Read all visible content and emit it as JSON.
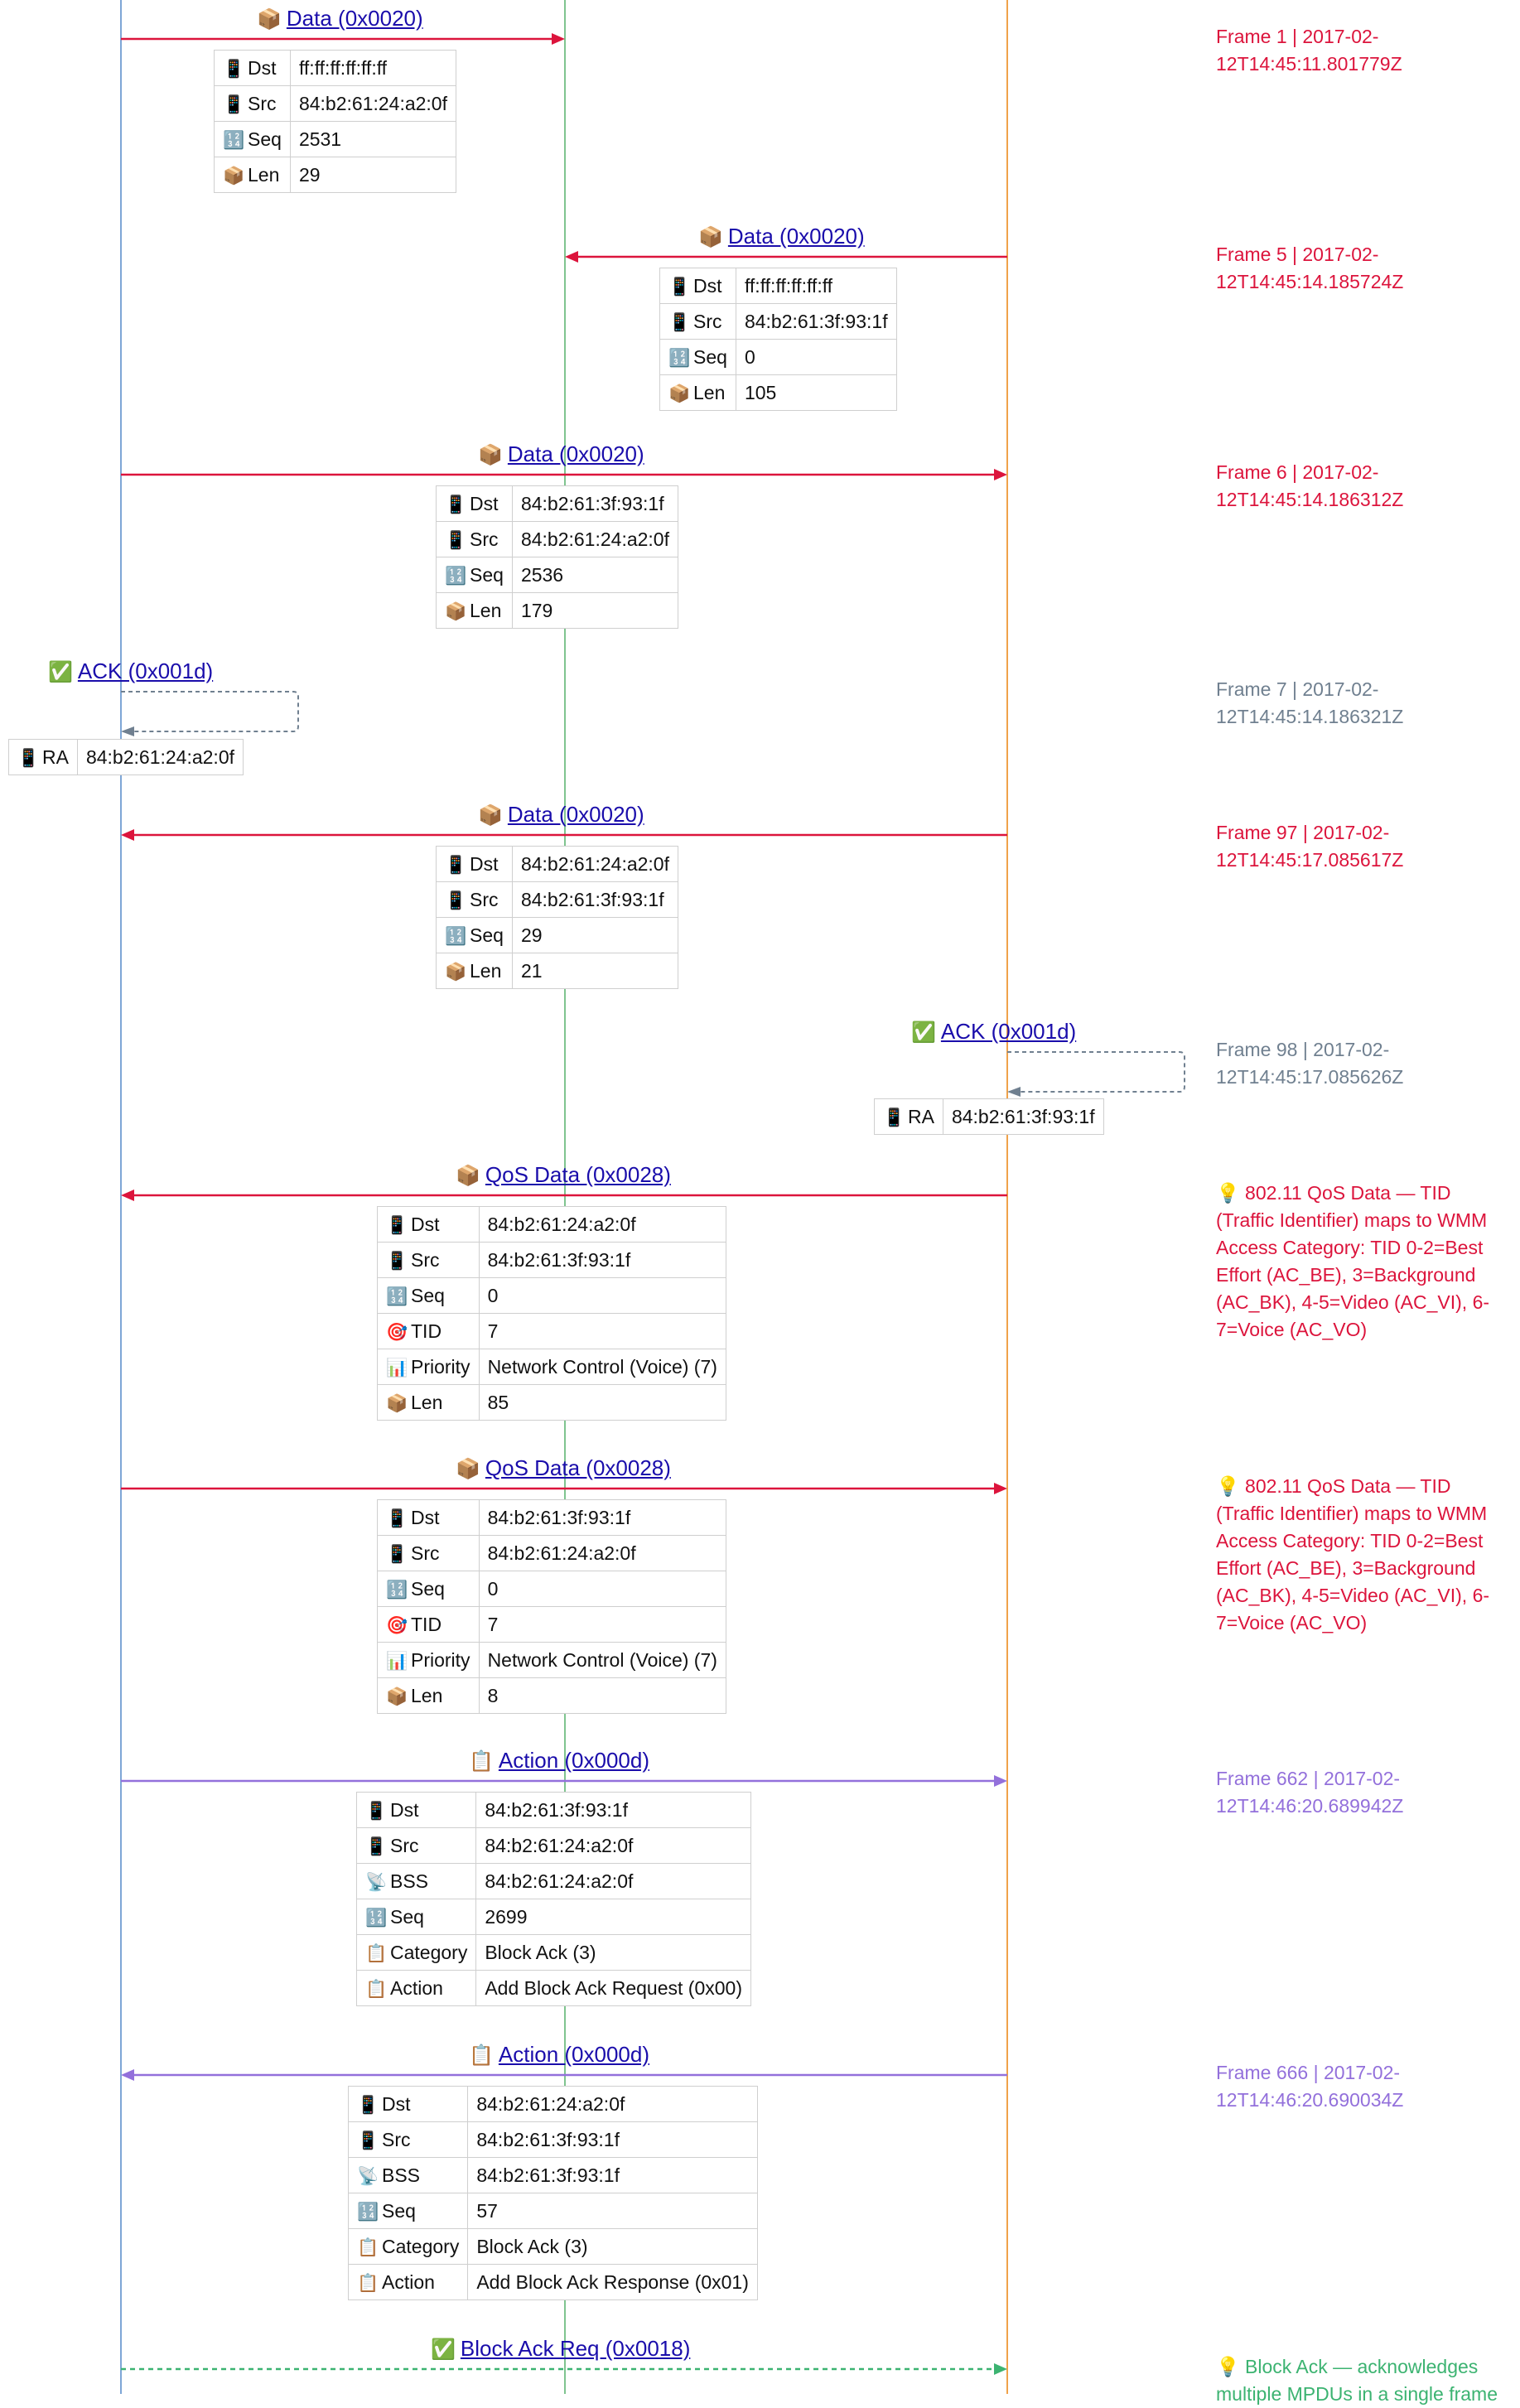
{
  "colors": {
    "lifeline_left": "#7ea6d6",
    "lifeline_mid": "#7fc48f",
    "lifeline_right": "#f0a24a",
    "data": "#dc143c",
    "ack": "#708090",
    "action": "#9370db",
    "blockack": "#3cb371",
    "link": "#1a0dab"
  },
  "messages": [
    {
      "label": "Data (0x0020)",
      "icon": "package-icon",
      "note": "Frame 1 | 2017-02-12T14:45:11.801779Z",
      "fields": [
        [
          "phone-icon",
          "Dst",
          "ff:ff:ff:ff:ff:ff"
        ],
        [
          "phone-icon",
          "Src",
          "84:b2:61:24:a2:0f"
        ],
        [
          "numbers-icon",
          "Seq",
          "2531"
        ],
        [
          "package-icon",
          "Len",
          "29"
        ]
      ]
    },
    {
      "label": "Data (0x0020)",
      "icon": "package-icon",
      "note": "Frame 5 | 2017-02-12T14:45:14.185724Z",
      "fields": [
        [
          "phone-icon",
          "Dst",
          "ff:ff:ff:ff:ff:ff"
        ],
        [
          "phone-icon",
          "Src",
          "84:b2:61:3f:93:1f"
        ],
        [
          "numbers-icon",
          "Seq",
          "0"
        ],
        [
          "package-icon",
          "Len",
          "105"
        ]
      ]
    },
    {
      "label": "Data (0x0020)",
      "icon": "package-icon",
      "note": "Frame 6 | 2017-02-12T14:45:14.186312Z",
      "fields": [
        [
          "phone-icon",
          "Dst",
          "84:b2:61:3f:93:1f"
        ],
        [
          "phone-icon",
          "Src",
          "84:b2:61:24:a2:0f"
        ],
        [
          "numbers-icon",
          "Seq",
          "2536"
        ],
        [
          "package-icon",
          "Len",
          "179"
        ]
      ]
    },
    {
      "label": "ACK (0x001d)",
      "icon": "check-icon",
      "note": "Frame 7 | 2017-02-12T14:45:14.186321Z",
      "fields": [
        [
          "phone-icon",
          "RA",
          "84:b2:61:24:a2:0f"
        ]
      ]
    },
    {
      "label": "Data (0x0020)",
      "icon": "package-icon",
      "note": "Frame 97 | 2017-02-12T14:45:17.085617Z",
      "fields": [
        [
          "phone-icon",
          "Dst",
          "84:b2:61:24:a2:0f"
        ],
        [
          "phone-icon",
          "Src",
          "84:b2:61:3f:93:1f"
        ],
        [
          "numbers-icon",
          "Seq",
          "29"
        ],
        [
          "package-icon",
          "Len",
          "21"
        ]
      ]
    },
    {
      "label": "ACK (0x001d)",
      "icon": "check-icon",
      "note": "Frame 98 | 2017-02-12T14:45:17.085626Z",
      "fields": [
        [
          "phone-icon",
          "RA",
          "84:b2:61:3f:93:1f"
        ]
      ]
    },
    {
      "label": "QoS Data (0x0028)",
      "icon": "package-icon",
      "note": "💡 802.11 QoS Data — TID (Traffic Identifier) maps to WMM Access Category: TID 0-2=Best Effort (AC_BE), 3=Background (AC_BK), 4-5=Video (AC_VI), 6-7=Voice (AC_VO)",
      "fields": [
        [
          "phone-icon",
          "Dst",
          "84:b2:61:24:a2:0f"
        ],
        [
          "phone-icon",
          "Src",
          "84:b2:61:3f:93:1f"
        ],
        [
          "numbers-icon",
          "Seq",
          "0"
        ],
        [
          "target-icon",
          "TID",
          "7"
        ],
        [
          "bar-chart-icon",
          "Priority",
          "Network Control (Voice) (7)"
        ],
        [
          "package-icon",
          "Len",
          "85"
        ]
      ]
    },
    {
      "label": "QoS Data (0x0028)",
      "icon": "package-icon",
      "note": "💡 802.11 QoS Data — TID (Traffic Identifier) maps to WMM Access Category: TID 0-2=Best Effort (AC_BE), 3=Background (AC_BK), 4-5=Video (AC_VI), 6-7=Voice (AC_VO)",
      "fields": [
        [
          "phone-icon",
          "Dst",
          "84:b2:61:3f:93:1f"
        ],
        [
          "phone-icon",
          "Src",
          "84:b2:61:24:a2:0f"
        ],
        [
          "numbers-icon",
          "Seq",
          "0"
        ],
        [
          "target-icon",
          "TID",
          "7"
        ],
        [
          "bar-chart-icon",
          "Priority",
          "Network Control (Voice) (7)"
        ],
        [
          "package-icon",
          "Len",
          "8"
        ]
      ]
    },
    {
      "label": "Action (0x000d)",
      "icon": "clipboard-icon",
      "note": "Frame 662 | 2017-02-12T14:46:20.689942Z",
      "fields": [
        [
          "phone-icon",
          "Dst",
          "84:b2:61:3f:93:1f"
        ],
        [
          "phone-icon",
          "Src",
          "84:b2:61:24:a2:0f"
        ],
        [
          "antenna-icon",
          "BSS",
          "84:b2:61:24:a2:0f"
        ],
        [
          "numbers-icon",
          "Seq",
          "2699"
        ],
        [
          "clipboard-icon",
          "Category",
          "Block Ack (3)"
        ],
        [
          "clipboard-icon",
          "Action",
          "Add Block Ack Request (0x00)"
        ]
      ]
    },
    {
      "label": "Action (0x000d)",
      "icon": "clipboard-icon",
      "note": "Frame 666 | 2017-02-12T14:46:20.690034Z",
      "fields": [
        [
          "phone-icon",
          "Dst",
          "84:b2:61:24:a2:0f"
        ],
        [
          "phone-icon",
          "Src",
          "84:b2:61:3f:93:1f"
        ],
        [
          "antenna-icon",
          "BSS",
          "84:b2:61:3f:93:1f"
        ],
        [
          "numbers-icon",
          "Seq",
          "57"
        ],
        [
          "clipboard-icon",
          "Category",
          "Block Ack (3)"
        ],
        [
          "clipboard-icon",
          "Action",
          "Add Block Ack Response (0x01)"
        ]
      ]
    },
    {
      "label": "Block Ack Req (0x0018)",
      "icon": "check-icon",
      "note": "💡 Block Ack — acknowledges multiple MPDUs in a single frame",
      "fields": []
    }
  ]
}
